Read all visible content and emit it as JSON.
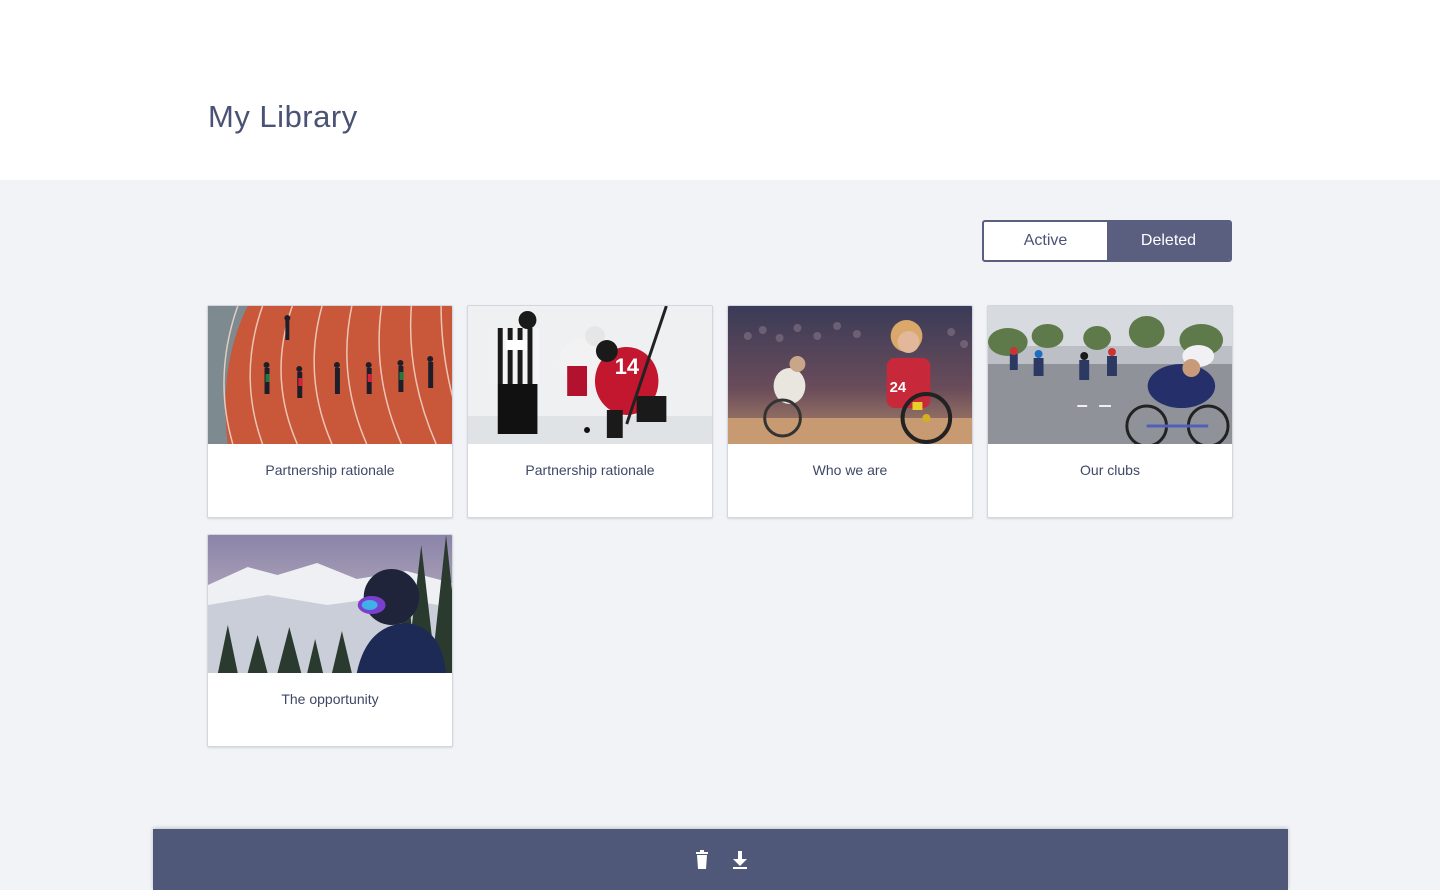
{
  "page": {
    "title": "My Library"
  },
  "filter": {
    "options": [
      {
        "label": "Active",
        "selected": false
      },
      {
        "label": "Deleted",
        "selected": true
      }
    ]
  },
  "cards": [
    {
      "title": "Partnership rationale",
      "image": "running-track-athletes"
    },
    {
      "title": "Partnership rationale",
      "image": "ice-hockey-faceoff"
    },
    {
      "title": "Who we are",
      "image": "wheelchair-rugby-player"
    },
    {
      "title": "Our clubs",
      "image": "road-cyclists-race"
    },
    {
      "title": "The opportunity",
      "image": "snowboarder-mountain"
    }
  ],
  "action_bar": {
    "buttons": [
      {
        "icon": "trash-icon"
      },
      {
        "icon": "download-icon"
      }
    ]
  },
  "colors": {
    "accent": "#5a5f80",
    "action_bar": "#4f5878",
    "background": "#f2f3f7"
  }
}
